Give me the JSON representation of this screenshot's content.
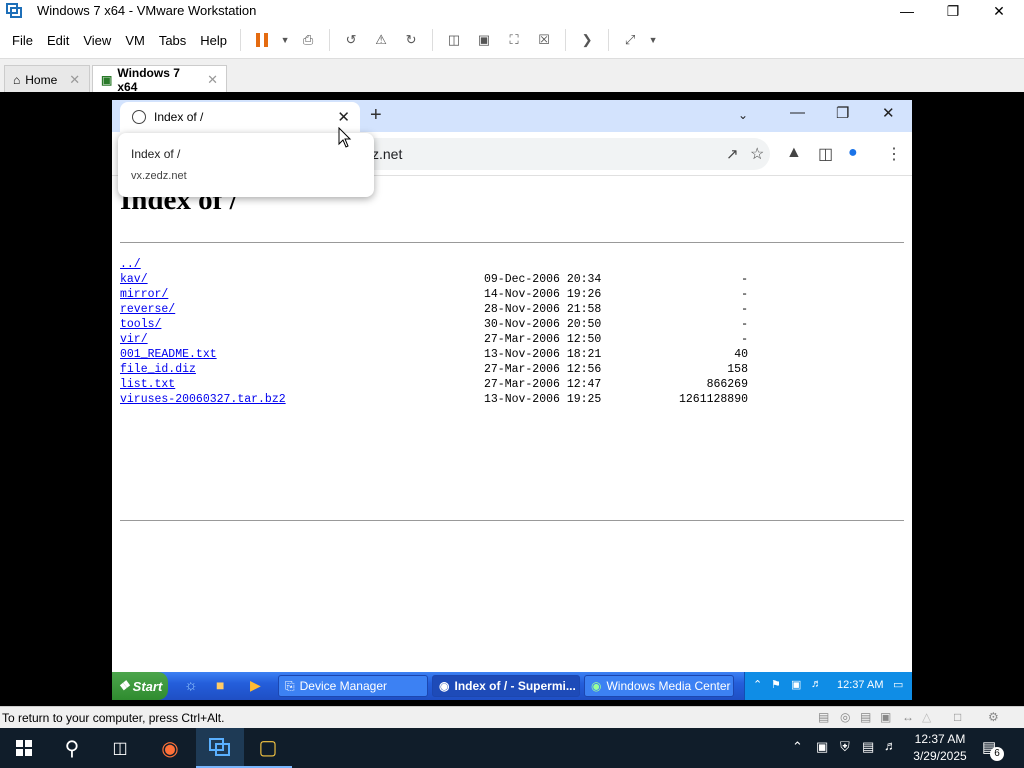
{
  "vmware": {
    "title": "Windows 7 x64 - VMware Workstation",
    "menu": [
      "File",
      "Edit",
      "View",
      "VM",
      "Tabs",
      "Help"
    ],
    "tabs": [
      {
        "label": "Home"
      },
      {
        "label": "Windows 7 x64"
      }
    ],
    "status_message": "To return to your computer, press Ctrl+Alt."
  },
  "chrome": {
    "tab_title": "Index of /",
    "omnibox_text": "z.net",
    "tooltip": {
      "title": "Index of /",
      "host": "vx.zedz.net"
    }
  },
  "listing": {
    "heading": "Index of /",
    "rows": [
      {
        "name": "../",
        "date": "",
        "size": ""
      },
      {
        "name": "kav/",
        "date": "09-Dec-2006 20:34",
        "size": "-"
      },
      {
        "name": "mirror/",
        "date": "14-Nov-2006 19:26",
        "size": "-"
      },
      {
        "name": "reverse/",
        "date": "28-Nov-2006 21:58",
        "size": "-"
      },
      {
        "name": "tools/",
        "date": "30-Nov-2006 20:50",
        "size": "-"
      },
      {
        "name": "vir/",
        "date": "27-Mar-2006 12:50",
        "size": "-"
      },
      {
        "name": "001_README.txt",
        "date": "13-Nov-2006 18:21",
        "size": "40"
      },
      {
        "name": "file_id.diz",
        "date": "27-Mar-2006 12:56",
        "size": "158"
      },
      {
        "name": "list.txt",
        "date": "27-Mar-2006 12:47",
        "size": "866269"
      },
      {
        "name": "viruses-20060327.tar.bz2",
        "date": "13-Nov-2006 19:25",
        "size": "1261128890"
      }
    ]
  },
  "guest_taskbar": {
    "start_label": "Start",
    "buttons": [
      "Device Manager",
      "Index of / - Supermi...",
      "Windows Media Center"
    ],
    "clock": "12:37 AM"
  },
  "host_taskbar": {
    "time": "12:37 AM",
    "date": "3/29/2025",
    "notification_count": "6"
  },
  "colors": {
    "vm_black": "#000000",
    "xp_blue": "#245edb",
    "link": "#0000ee",
    "host_taskbar": "#101d2a"
  }
}
